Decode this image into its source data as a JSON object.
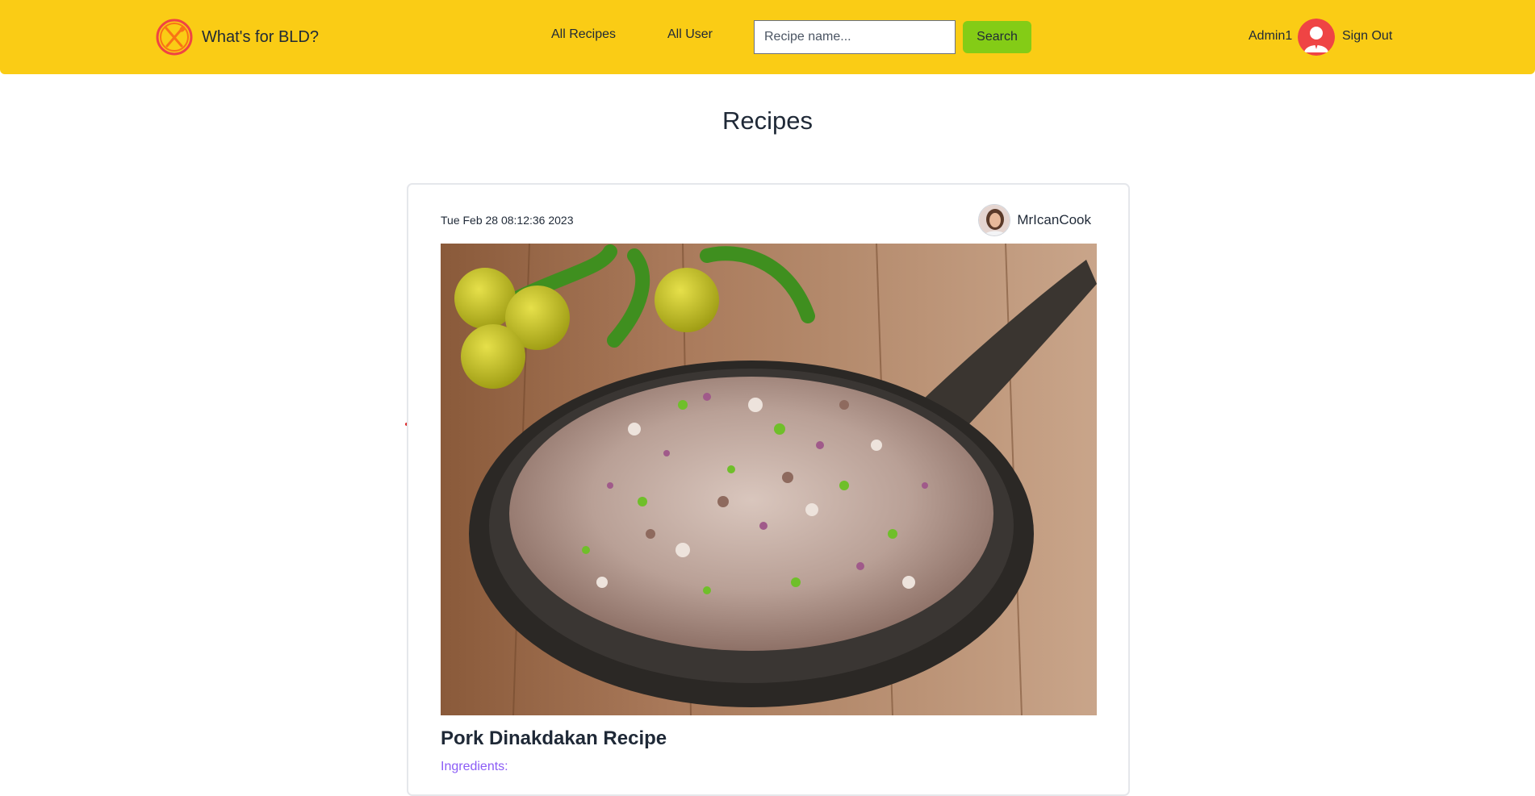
{
  "brand": {
    "name": "What's for BLD?",
    "logo_icon": "plate-fork-spoon-icon",
    "logo_color": "#f97316"
  },
  "nav": {
    "all_recipes": "All Recipes",
    "all_user": "All User"
  },
  "search": {
    "placeholder": "Recipe name...",
    "value": "",
    "button_label": "Search"
  },
  "user": {
    "name": "Admin1",
    "avatar_icon": "user-avatar-icon",
    "sign_out": "Sign Out"
  },
  "page": {
    "title": "Recipes"
  },
  "recipe": {
    "date": "Tue Feb 28 08:12:36 2023",
    "author": "MrIcanCook",
    "author_avatar_icon": "author-avatar-icon",
    "photo_icon": "dinakdakan-dish-photo",
    "title": "Pork Dinakdakan Recipe",
    "ingredients_label": "Ingredients:"
  },
  "colors": {
    "header_bg": "#facc15",
    "search_button": "#84cc16",
    "ingredients_label": "#8b5cf6"
  }
}
